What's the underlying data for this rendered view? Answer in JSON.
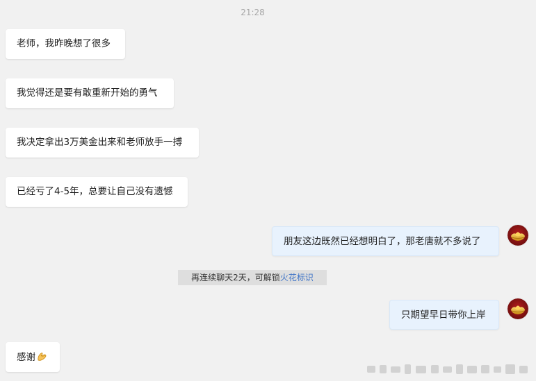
{
  "conversation": {
    "timestamp": "21:28",
    "messages": [
      {
        "side": "left",
        "text": "老师，我昨晚想了很多"
      },
      {
        "side": "left",
        "text": "我觉得还是要有敢重新开始的勇气"
      },
      {
        "side": "left",
        "text": "我决定拿出3万美金出来和老师放手一搏"
      },
      {
        "side": "left",
        "text": "已经亏了4-5年，总要让自己没有遗憾"
      },
      {
        "side": "right",
        "text": "朋友这边既然已经想明白了，那老唐就不多说了"
      },
      {
        "side": "right",
        "text": "只期望早日带你上岸"
      },
      {
        "side": "left",
        "text": "感谢",
        "emoji": "pray-hands-icon"
      }
    ],
    "system_note": {
      "prefix": "再连续聊天2天，可解锁",
      "link": "火花标识"
    }
  },
  "colors": {
    "background": "#f1f1f1",
    "left_bubble": "#ffffff",
    "right_bubble": "#e8f2fd",
    "link": "#3f74c7"
  },
  "icons": {
    "avatar": "gold-ingot-avatar-icon",
    "emoji": "pray-hands-icon"
  }
}
